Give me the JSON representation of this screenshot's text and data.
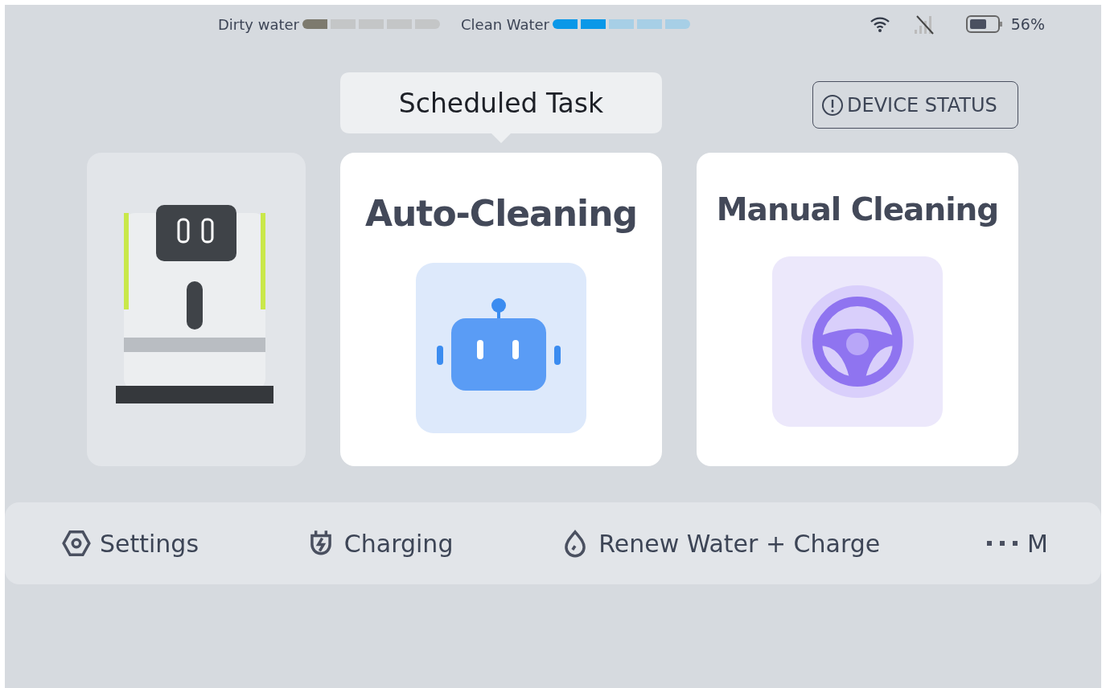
{
  "status_bar": {
    "gauges": [
      {
        "label": "Dirty water",
        "kind": "dirty",
        "level": 0.2
      },
      {
        "label": "Clean Water",
        "kind": "clean",
        "level": 0.4
      }
    ],
    "battery": "56%"
  },
  "tooltip": {
    "text": "Scheduled Task"
  },
  "device_status": {
    "label": "DEVICE STATUS"
  },
  "modes": [
    {
      "title": "Auto-Cleaning",
      "kind": "auto"
    },
    {
      "title": "Manual Cleaning",
      "kind": "manual"
    }
  ],
  "bottom_bar": [
    {
      "label": "Settings",
      "kind": "settings"
    },
    {
      "label": "Charging",
      "kind": "charging"
    },
    {
      "label": "Renew Water + Charge",
      "kind": "water"
    },
    {
      "label": "M",
      "kind": "more"
    }
  ]
}
